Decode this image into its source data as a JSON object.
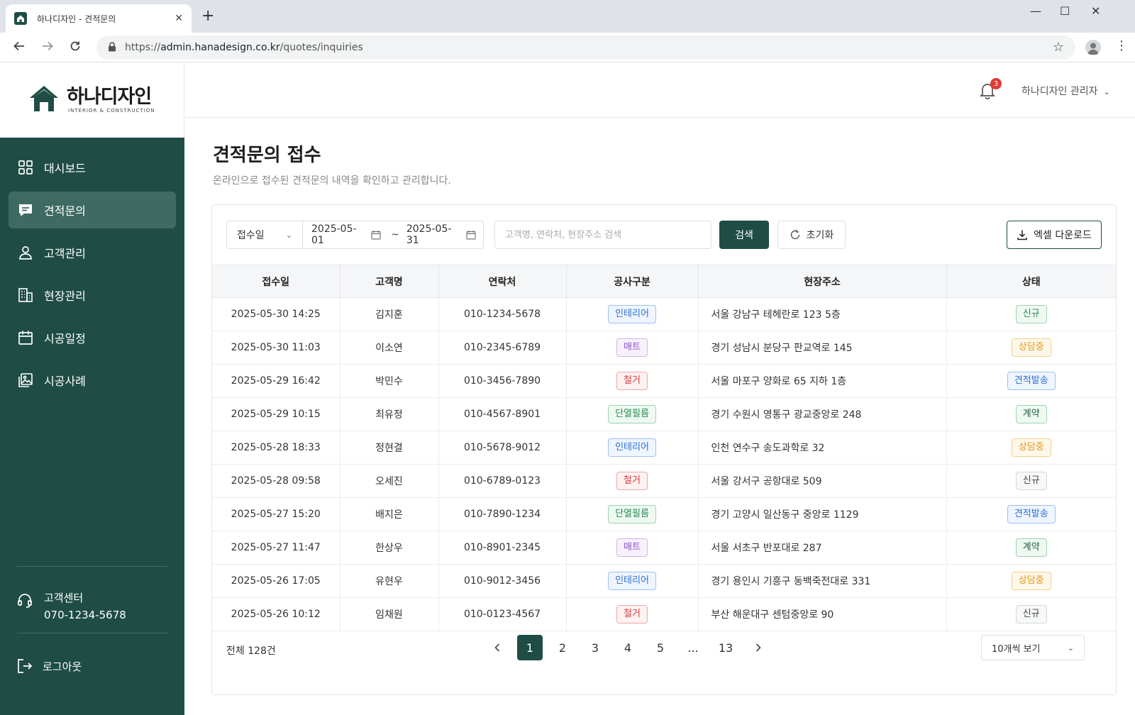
{
  "browser": {
    "tab_title": "하나디자인 - 견적문의",
    "url_prefix": "https://",
    "url_host": "admin.hanadesign.co.kr",
    "url_path": "/quotes/inquiries"
  },
  "brand": {
    "name": "하나디자인",
    "tagline": "INTERIOR & CONSTRUCTION",
    "primary_color": "#1f4d45"
  },
  "sidebar": {
    "items": [
      {
        "label": "대시보드",
        "icon": "dashboard-grid-icon",
        "active": false
      },
      {
        "label": "견적문의",
        "icon": "chat-message-icon",
        "active": true
      },
      {
        "label": "고객관리",
        "icon": "user-icon",
        "active": false
      },
      {
        "label": "현장관리",
        "icon": "building-icon",
        "active": false
      },
      {
        "label": "시공일정",
        "icon": "calendar-icon",
        "active": false
      },
      {
        "label": "시공사례",
        "icon": "image-gallery-icon",
        "active": false
      }
    ],
    "support_label": "고객센터",
    "support_phone": "070-1234-5678",
    "logout_label": "로그아웃"
  },
  "header": {
    "notification_count": "3",
    "user_name": "하나디자인 관리자"
  },
  "page": {
    "title": "견적문의 접수",
    "description": "온라인으로 접수된 견적문의 내역을 확인하고 관리합니다."
  },
  "filters": {
    "date_type": "접수일",
    "date_from": "2025-05-01",
    "date_sep": "~",
    "date_to": "2025-05-31",
    "search_placeholder": "고객명, 연락처, 현장주소 검색",
    "search_label": "검색",
    "reset_label": "초기화",
    "excel_label": "엑셀 다운로드"
  },
  "table": {
    "columns": [
      "접수일",
      "고객명",
      "연락처",
      "공사구분",
      "현장주소",
      "상태"
    ],
    "rows": [
      {
        "date": "2025-05-30 14:25",
        "name": "김지훈",
        "phone": "010-1234-5678",
        "type": "인테리어",
        "type_color": "blue",
        "address": "서울 강남구 테헤란로 123 5층",
        "status": "신규",
        "status_color": "green"
      },
      {
        "date": "2025-05-30 11:03",
        "name": "이소연",
        "phone": "010-2345-6789",
        "type": "매트",
        "type_color": "purple",
        "address": "경기 성남시 분당구 판교역로 145",
        "status": "상담중",
        "status_color": "orange"
      },
      {
        "date": "2025-05-29 16:42",
        "name": "박민수",
        "phone": "010-3456-7890",
        "type": "철거",
        "type_color": "red",
        "address": "서울 마포구 양화로 65 지하 1층",
        "status": "견적발송",
        "status_color": "blue"
      },
      {
        "date": "2025-05-29 10:15",
        "name": "최유정",
        "phone": "010-4567-8901",
        "type": "단열필름",
        "type_color": "green",
        "address": "경기 수원시 영통구 광교중앙로 248",
        "status": "계약",
        "status_color": "dkgreen"
      },
      {
        "date": "2025-05-28 18:33",
        "name": "정현결",
        "phone": "010-5678-9012",
        "type": "인테리어",
        "type_color": "blue",
        "address": "인천 연수구 송도과학로 32",
        "status": "상담중",
        "status_color": "orange"
      },
      {
        "date": "2025-05-28 09:58",
        "name": "오세진",
        "phone": "010-6789-0123",
        "type": "철거",
        "type_color": "red",
        "address": "서울 강서구 공항대로 509",
        "status": "신규",
        "status_color": "gray"
      },
      {
        "date": "2025-05-27 15:20",
        "name": "배지은",
        "phone": "010-7890-1234",
        "type": "단열필름",
        "type_color": "green",
        "address": "경기 고양시 일산동구 중앙로 1129",
        "status": "견적발송",
        "status_color": "blue"
      },
      {
        "date": "2025-05-27 11:47",
        "name": "한상우",
        "phone": "010-8901-2345",
        "type": "매트",
        "type_color": "purple",
        "address": "서울 서초구 반포대로 287",
        "status": "계약",
        "status_color": "dkgreen"
      },
      {
        "date": "2025-05-26 17:05",
        "name": "유현우",
        "phone": "010-9012-3456",
        "type": "인테리어",
        "type_color": "blue",
        "address": "경기 용인시 기흥구 동백죽전대로 331",
        "status": "상담중",
        "status_color": "orange"
      },
      {
        "date": "2025-05-26 10:12",
        "name": "임채원",
        "phone": "010-0123-4567",
        "type": "철거",
        "type_color": "red",
        "address": "부산 해운대구 센텀중앙로 90",
        "status": "신규",
        "status_color": "gray"
      }
    ]
  },
  "pagination": {
    "total": "전체 128건",
    "pages": [
      "1",
      "2",
      "3",
      "4",
      "5",
      "...",
      "13"
    ],
    "current": "1",
    "per_page": "10개씩 보기"
  }
}
